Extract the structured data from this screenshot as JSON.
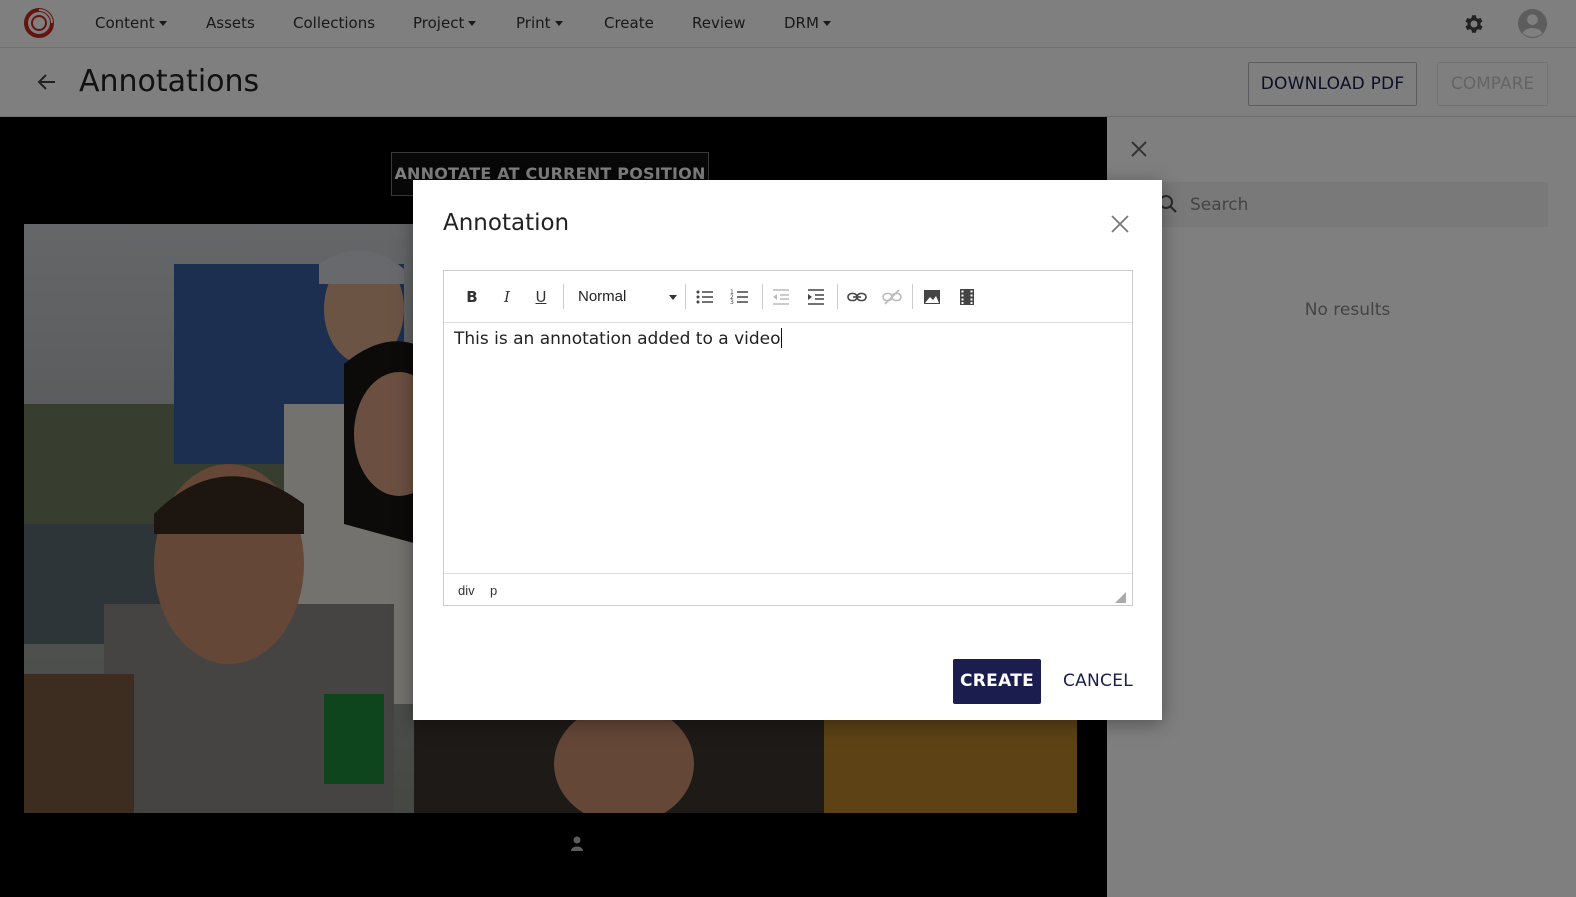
{
  "nav": {
    "logo": "app-logo",
    "items": [
      {
        "label": "Content",
        "dropdown": true
      },
      {
        "label": "Assets",
        "dropdown": false
      },
      {
        "label": "Collections",
        "dropdown": false
      },
      {
        "label": "Project",
        "dropdown": true
      },
      {
        "label": "Print",
        "dropdown": true
      },
      {
        "label": "Create",
        "dropdown": false
      },
      {
        "label": "Review",
        "dropdown": false
      },
      {
        "label": "DRM",
        "dropdown": true
      }
    ],
    "settings_icon": "gear-icon",
    "user_icon": "user-avatar-icon"
  },
  "header": {
    "title": "Annotations",
    "download_pdf": "DOWNLOAD PDF",
    "compare": "COMPARE"
  },
  "video": {
    "annotate_button": "ANNOTATE AT CURRENT POSITION"
  },
  "side_panel": {
    "search_placeholder": "Search",
    "empty_text": "No results"
  },
  "modal": {
    "title": "Annotation",
    "toolbar": {
      "format_value": "Normal"
    },
    "content": "This is an annotation added to a video",
    "path": [
      "div",
      "p"
    ],
    "create": "CREATE",
    "cancel": "CANCEL"
  },
  "colors": {
    "primary": "#1a1d4d",
    "logo": "#c8281f"
  }
}
